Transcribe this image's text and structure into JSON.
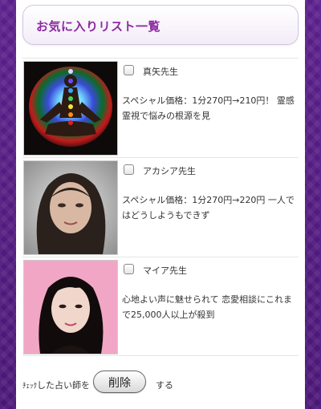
{
  "header": {
    "title": "お気に入りリスト一覧"
  },
  "items": [
    {
      "name": "真矢先生",
      "description": "スペシャル価格：1分270円→210円！ 霊感霊視で悩みの根源を見",
      "image": "chakra-meditation-image"
    },
    {
      "name": "アカシア先生",
      "description": "スペシャル価格：1分270円→220円 一人ではどうしようもできず",
      "image": "portrait-woman-image"
    },
    {
      "name": "マイア先生",
      "description": "心地よい声に魅せられて 恋愛相談にこれまで25,000人以上が殺到",
      "image": "portrait-woman-image"
    }
  ],
  "footer": {
    "pre_small": "ﾁｪｯｸ",
    "pre_text": "した占い師を",
    "delete_label": "削除",
    "post_text": "する"
  },
  "colors": {
    "background": "#5a1f8a",
    "title": "#8d2aa0"
  }
}
